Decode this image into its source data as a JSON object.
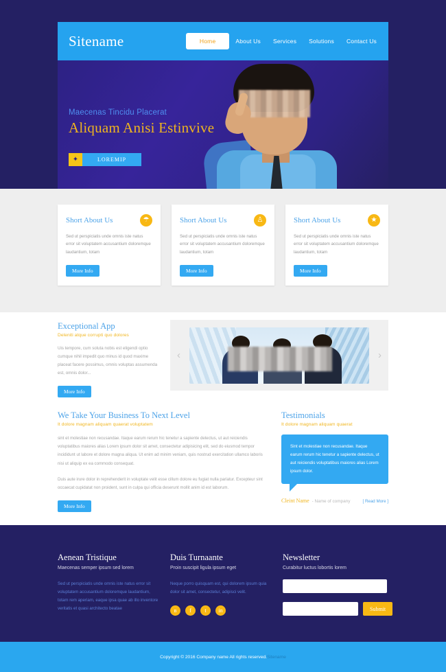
{
  "header": {
    "brand": "Sitename",
    "nav": [
      {
        "label": "Home",
        "active": true
      },
      {
        "label": "About Us",
        "active": false
      },
      {
        "label": "Services",
        "active": false
      },
      {
        "label": "Solutions",
        "active": false
      },
      {
        "label": "Contact Us",
        "active": false
      }
    ]
  },
  "hero": {
    "subtitle": "Maecenas Tincidu Placerat",
    "title": "Aliquam Anisi Estinvive",
    "button_icon": "puzzle-piece-icon",
    "button_label": "LOREMIP"
  },
  "cards": [
    {
      "title": "Short About Us",
      "icon": "umbrella-icon",
      "icon_glyph": "☂",
      "body": "Sed ut perspiciatis unde omnis iste natus error sit voluptatem accusantium doloremque laudantium, totam",
      "button": "More Info"
    },
    {
      "title": "Short About Us",
      "icon": "lightbulb-icon",
      "icon_glyph": "♙",
      "body": "Sed ut perspiciatis unde omnis iste natus error sit voluptatem accusantium doloremque laudantium, totam",
      "button": "More Info"
    },
    {
      "title": "Short About Us",
      "icon": "star-icon",
      "icon_glyph": "★",
      "body": "Sed ut perspiciatis unde omnis iste natus error sit voluptatem accusantium doloremque laudantium, totam",
      "button": "More Info"
    }
  ],
  "exceptional": {
    "title": "Exceptional App",
    "subtitle": "Deleniti atque corrupti quo dolores",
    "body": "Uis tempore, cum soluta nobis est eligendi optio cumque nihil impedit quo minus id quod maxime placeat facere possimus, omnis voluptas assumenda est, omnis dolor...",
    "button": "More Info"
  },
  "carousel": {
    "prev_icon": "chevron-left-icon",
    "next_icon": "chevron-right-icon",
    "prev_glyph": "‹",
    "next_glyph": "›"
  },
  "business": {
    "title": "We Take Your Business To Next Level",
    "subtitle": "It dolore magnam aliquam quaerat voluptatem",
    "paragraph1": "sint et molestiae non recusandae. Itaque earum rerum hic tenetur a sapiente delectus, ut aut reiciendis voluptatibus maiores alias Lorem ipsum dolor sit amet, consectetur adipisicing elit, sed do eiusmod tempor incididunt ut labore et dolore magna aliqua. Ut enim ad minim veniam, quis nostrud exercitation ullamco laboris nisi ut aliquip ex ea commodo consequat.",
    "paragraph2": "Duis aute irure dolor in reprehenderit in voluptate velit esse cillum dolore eu fugiat nulla pariatur. Excepteur sint occaecat cupidatat non proident, sunt in culpa qui officia deserunt mollit anim id est laborum.",
    "button": "More Info"
  },
  "testimonials": {
    "title": "Testimonials",
    "subtitle": "It dolore magnam aliquam quaerat",
    "quote": "Sint et molestiae non recusandae. Itaque earum rerum hic tenetur a sapiente delectus, ut aut reiciendis voluptatibus maiores alias Lorem ipsum dolor.",
    "client_name": "Cleint Name",
    "client_company": "- Name of company",
    "read_more": "[ Read More ]"
  },
  "footer": {
    "col1": {
      "title": "Aenean Tristique",
      "subtitle": "Maecenas semper ipsum sed lorem",
      "text": "Sed ut perspiciatis unde omnis iste natus error sit voluptatem accusantium doloremque laudantium, totam rem aperiam, eaque ipsa quae ab illo inventore veritatis et quasi architecto beatae"
    },
    "col2": {
      "title": "Duis Turnaante",
      "subtitle": "Proin suscipit ligula ipsum eget",
      "text": "Neque porro quisquam est, qui dolorem ipsum quia dolor sit amet, consectetur, adipisci velit.",
      "socials": [
        {
          "name": "behance-icon",
          "glyph": "ʙ"
        },
        {
          "name": "facebook-icon",
          "glyph": "f"
        },
        {
          "name": "twitter-icon",
          "glyph": "t"
        },
        {
          "name": "linkedin-icon",
          "glyph": "in"
        }
      ]
    },
    "col3": {
      "title": "Newsletter",
      "subtitle": "Curabitur luctus lobortis lorem",
      "field1_value": "",
      "field1_placeholder": "",
      "field2_value": "",
      "field2_placeholder": "",
      "submit_label": "Submit"
    }
  },
  "copyright": {
    "text": "Copyright © 2016 Company name All rights reserved.",
    "link": "Sitename"
  },
  "colors": {
    "nav_blue": "#25a3ef",
    "hero_purple": "#2b2180",
    "accent_yellow": "#f8b814",
    "accent_gold": "#f0b51e",
    "button_blue": "#33a9f2",
    "footer_navy": "#242063",
    "copy_blue": "#2aa7ef",
    "cards_bg": "#eeeeee"
  }
}
